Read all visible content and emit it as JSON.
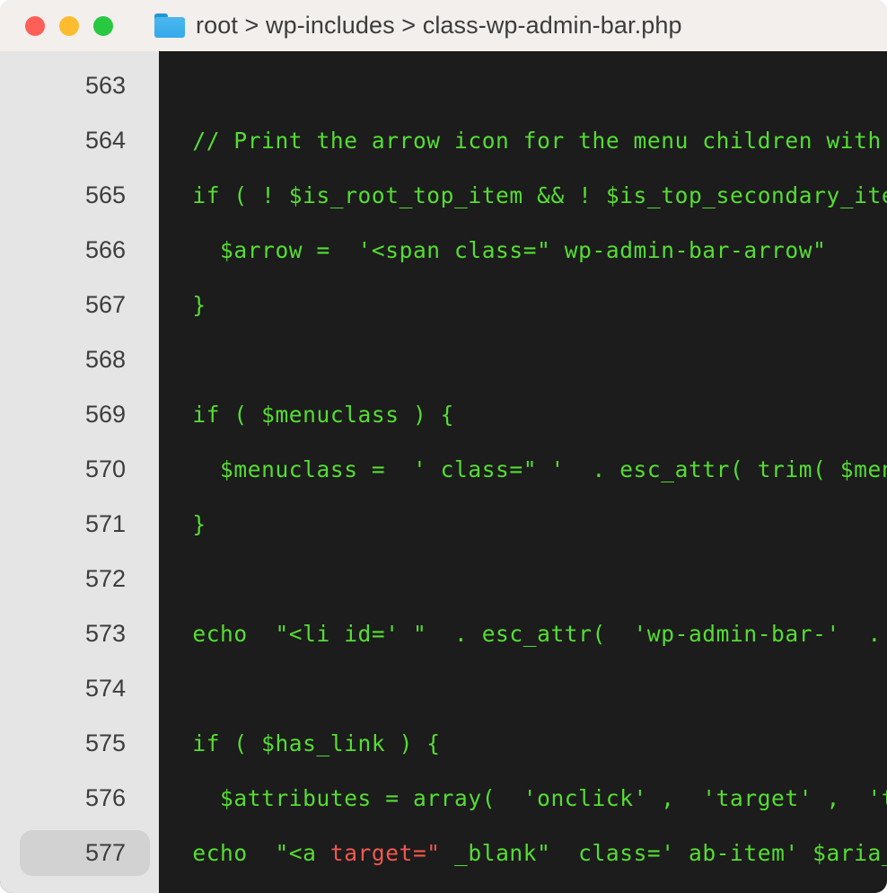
{
  "window": {
    "traffic_lights": [
      {
        "name": "close",
        "color": "#fe5f57"
      },
      {
        "name": "minimize",
        "color": "#fdbc2d"
      },
      {
        "name": "zoom",
        "color": "#28c840"
      }
    ],
    "folder_icon": "folder-icon",
    "breadcrumb": "root > wp-includes > class-wp-admin-bar.php",
    "path_segments": [
      "root",
      "wp-includes",
      "class-wp-admin-bar.php"
    ],
    "titlebar_background": "#f2efed"
  },
  "editor": {
    "language": "php",
    "background": "#1c1c1c",
    "gutter_background": "#e5e5e5",
    "text_color": "#55dd33",
    "accent_color": "#f0584f",
    "active_line": 577,
    "first_line": 563,
    "last_line": 577,
    "lines": [
      {
        "number": "563",
        "tokens": [
          {
            "text": "",
            "color": "green"
          }
        ]
      },
      {
        "number": "564",
        "tokens": [
          {
            "text": " // Print the arrow icon for the menu children with children.",
            "color": "green"
          }
        ]
      },
      {
        "number": "565",
        "tokens": [
          {
            "text": " if ( ! $is_root_top_item && ! $is_top_secondary_item && $is_",
            "color": "green"
          }
        ]
      },
      {
        "number": "566",
        "tokens": [
          {
            "text": "   $arrow =  '<span class=\" wp-admin-bar-arrow\"",
            "color": "green"
          }
        ]
      },
      {
        "number": "567",
        "tokens": [
          {
            "text": " }",
            "color": "green"
          }
        ]
      },
      {
        "number": "568",
        "tokens": [
          {
            "text": "",
            "color": "green"
          }
        ]
      },
      {
        "number": "569",
        "tokens": [
          {
            "text": " if ( $menuclass ) {",
            "color": "green"
          }
        ]
      },
      {
        "number": "570",
        "tokens": [
          {
            "text": "   $menuclass =  ' class=\" '  . esc_attr( trim( $menuclass )",
            "color": "green"
          }
        ]
      },
      {
        "number": "571",
        "tokens": [
          {
            "text": " }",
            "color": "green"
          }
        ]
      },
      {
        "number": "572",
        "tokens": [
          {
            "text": "",
            "color": "green"
          }
        ]
      },
      {
        "number": "573",
        "tokens": [
          {
            "text": " echo  \"<li id=' \"  . esc_attr(  'wp-admin-bar-'  . $node->id",
            "color": "green"
          }
        ]
      },
      {
        "number": "574",
        "tokens": [
          {
            "text": "",
            "color": "green"
          }
        ]
      },
      {
        "number": "575",
        "tokens": [
          {
            "text": " if ( $has_link ) {",
            "color": "green"
          }
        ]
      },
      {
        "number": "576",
        "tokens": [
          {
            "text": "   $attributes = array(  'onclick' ,  'target' ,  'title' ,",
            "color": "green"
          }
        ]
      },
      {
        "number": "577",
        "tokens": [
          {
            "text": " echo  \"<a ",
            "color": "green"
          },
          {
            "text": "target=\"",
            "color": "red"
          },
          {
            "text": " _blank\"  class=' ab-item' $aria_attribute",
            "color": "green"
          }
        ]
      }
    ]
  }
}
